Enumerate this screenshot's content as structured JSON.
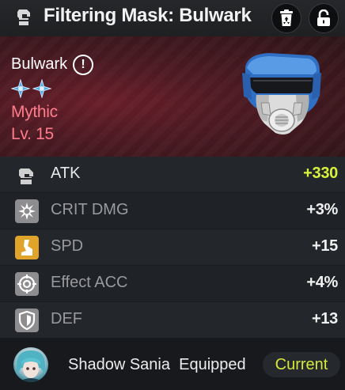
{
  "header": {
    "title": "Filtering Mask: Bulwark",
    "icons": [
      "mask-category-icon",
      "recycle-bin-icon",
      "unlocked-padlock-icon"
    ]
  },
  "item": {
    "name": "Bulwark",
    "star_count": 2,
    "rarity": "Mythic",
    "level": "Lv. 15",
    "colors": {
      "rarity": "#ff7c8c",
      "star": "#4fa6e8",
      "panel": "#4a1a22"
    }
  },
  "stats": [
    {
      "label": "ATK",
      "value": "+330",
      "icon": "atk-fist-icon",
      "primary": true
    },
    {
      "label": "CRIT DMG",
      "value": "+3%",
      "icon": "crit-burst-icon",
      "primary": false
    },
    {
      "label": "SPD",
      "value": "+15",
      "icon": "spd-boot-icon",
      "primary": false
    },
    {
      "label": "Effect ACC",
      "value": "+4%",
      "icon": "target-icon",
      "primary": false
    },
    {
      "label": "DEF",
      "value": "+13",
      "icon": "shield-icon",
      "primary": false
    }
  ],
  "equipped": {
    "character": "Shadow Sania",
    "status": "Equipped",
    "badge": "Current",
    "colors": {
      "badge_text": "#d5e83a",
      "main_stat": "#d9f23c"
    }
  }
}
